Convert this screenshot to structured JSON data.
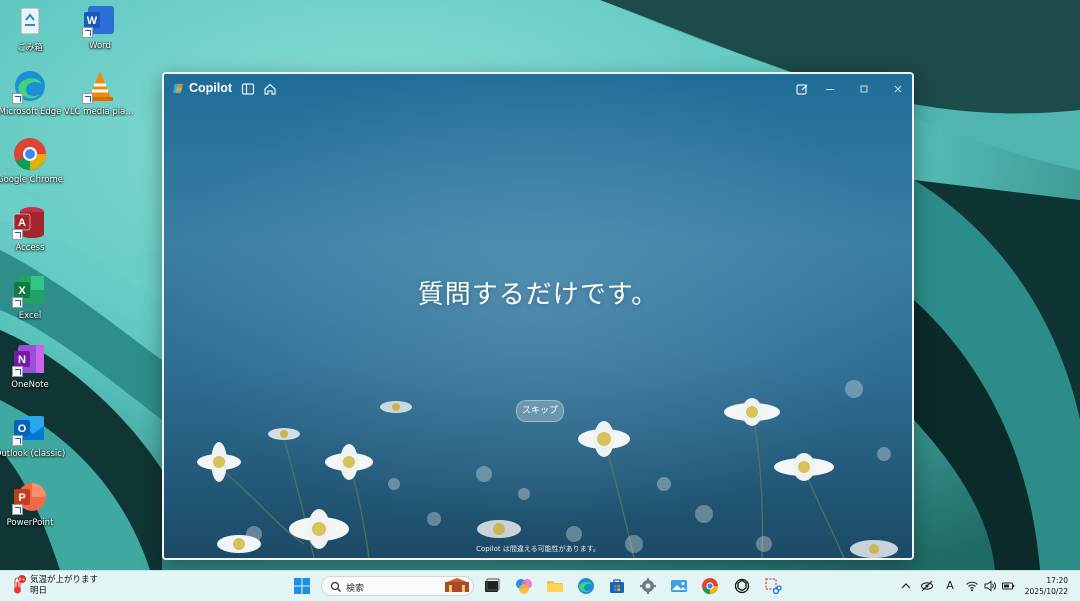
{
  "desktop": {
    "icons": [
      {
        "name": "recycle-bin",
        "label": "ごみ箱"
      },
      {
        "name": "word",
        "label": "Word"
      },
      {
        "name": "microsoft-edge",
        "label": "Microsoft Edge"
      },
      {
        "name": "vlc-media-player",
        "label": "VLC media player"
      },
      {
        "name": "google-chrome",
        "label": "Google Chrome"
      },
      {
        "name": "access",
        "label": "Access"
      },
      {
        "name": "excel",
        "label": "Excel"
      },
      {
        "name": "onenote",
        "label": "OneNote"
      },
      {
        "name": "outlook-classic",
        "label": "Outlook (classic)"
      },
      {
        "name": "powerpoint",
        "label": "PowerPoint"
      }
    ]
  },
  "copilot": {
    "app_name": "Copilot",
    "headline": "質問するだけです。",
    "skip_label": "スキップ",
    "disclaimer": "Copilot は間違える可能性があります。",
    "titlebar_icons": [
      "sidebar-icon",
      "home-icon",
      "new-chat-icon",
      "minimize-icon",
      "maximize-icon",
      "close-icon"
    ]
  },
  "taskbar": {
    "weather": {
      "badge": "9+",
      "line1": "気温が上がります",
      "line2": "明日"
    },
    "search_placeholder": "検索",
    "pinned": [
      "start-icon",
      "search-icon",
      "task-view-icon",
      "copilot-icon",
      "file-explorer-icon",
      "edge-icon",
      "store-icon",
      "settings-icon",
      "photos-icon",
      "chrome-icon",
      "chatgpt-icon",
      "snipping-tool-icon"
    ],
    "tray": {
      "ime": "A"
    },
    "clock": {
      "time": "17:20",
      "date": "2025/10/22"
    }
  },
  "colors": {
    "accent": "#2aa59f",
    "window_bg": "#2f6e94",
    "taskbar": "#e2f4f3"
  }
}
